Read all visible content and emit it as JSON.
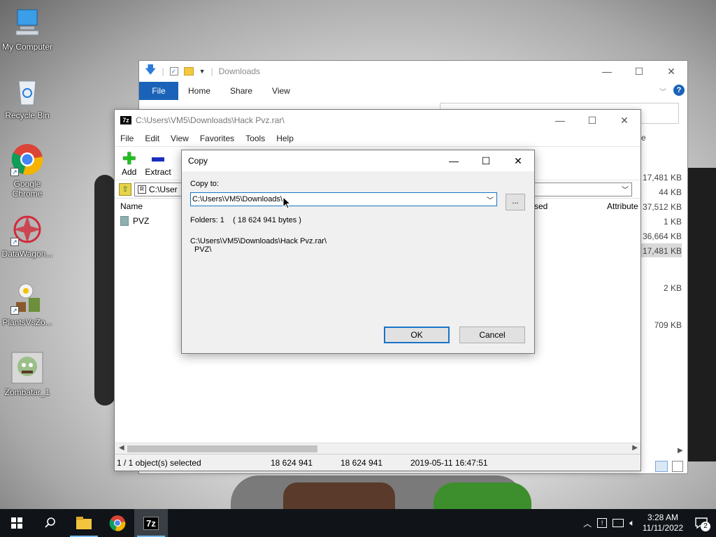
{
  "desktop_icons": [
    {
      "label": "My Computer",
      "icon": "computer-icon"
    },
    {
      "label": "Recycle Bin",
      "icon": "recycle-bin-icon"
    },
    {
      "label": "Google Chrome",
      "icon": "chrome-icon"
    },
    {
      "label": "DataWagon...",
      "icon": "datawagon-icon"
    },
    {
      "label": "PlantsVsZo...",
      "icon": "plants-vs-zombies-icon"
    },
    {
      "label": "Zombatar_1",
      "icon": "zombatar-icon"
    }
  ],
  "explorer": {
    "title": "Downloads",
    "ribbon_tabs": [
      "File",
      "Home",
      "Share",
      "View"
    ],
    "partial_column": "e",
    "sizes": [
      "17,481 KB",
      "44 KB",
      "37,512 KB",
      "1 KB",
      "36,664 KB",
      "17,481 KB",
      "2 KB",
      "709 KB"
    ]
  },
  "sevenzip": {
    "logo": "7z",
    "title": "C:\\Users\\VM5\\Downloads\\Hack Pvz.rar\\",
    "menu": [
      "File",
      "Edit",
      "View",
      "Favorites",
      "Tools",
      "Help"
    ],
    "toolbar": {
      "add": "Add",
      "extract": "Extract"
    },
    "address": "C:\\User",
    "columns": {
      "name": "Name",
      "sed": "sed",
      "attributes": "Attribute"
    },
    "rows": [
      {
        "name": "PVZ"
      }
    ],
    "status": {
      "selected": "1 / 1 object(s) selected",
      "size": "18 624 941",
      "packed": "18 624 941",
      "modified": "2019-05-11 16:47:51"
    }
  },
  "copy_dialog": {
    "title": "Copy",
    "copy_to_label": "Copy to:",
    "path_value": "C:\\Users\\VM5\\Downloads\\",
    "browse_label": "...",
    "info": "Folders: 1    ( 18 624 941 bytes )",
    "source_line1": "C:\\Users\\VM5\\Downloads\\Hack Pvz.rar\\",
    "source_line2": "PVZ\\",
    "ok_label": "OK",
    "cancel_label": "Cancel"
  },
  "taskbar": {
    "time": "3:28 AM",
    "date": "11/11/2022",
    "notification_count": "2"
  },
  "colors": {
    "accent": "#1a73c8",
    "ribbon_file": "#1a63b8",
    "taskbar": "#101418"
  }
}
